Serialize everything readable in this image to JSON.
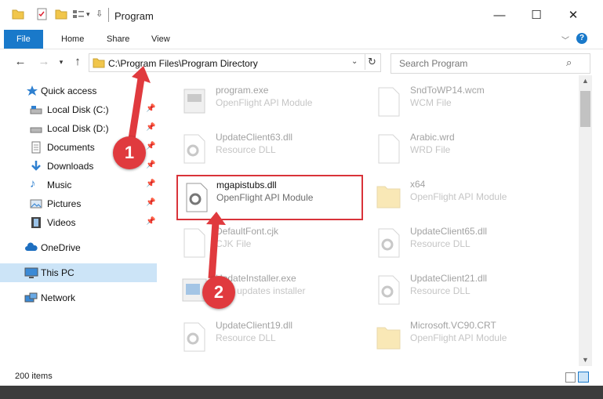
{
  "window": {
    "title": "Program"
  },
  "ribbon": {
    "tabs": [
      "File",
      "Home",
      "Share",
      "View"
    ]
  },
  "address": {
    "path": "C:\\Program Files\\Program Directory"
  },
  "search": {
    "placeholder": "Search Program"
  },
  "sidebar": {
    "items": [
      {
        "label": "Quick access"
      },
      {
        "label": "Local Disk (C:)"
      },
      {
        "label": "Local Disk (D:)"
      },
      {
        "label": "Documents"
      },
      {
        "label": "Downloads"
      },
      {
        "label": "Music"
      },
      {
        "label": "Pictures"
      },
      {
        "label": "Videos"
      },
      {
        "label": "OneDrive"
      },
      {
        "label": "This PC"
      },
      {
        "label": "Network"
      }
    ]
  },
  "files": [
    {
      "name": "program.exe",
      "desc": "OpenFlight API Module"
    },
    {
      "name": "SndToWP14.wcm",
      "desc": "WCM File"
    },
    {
      "name": "UpdateClient63.dll",
      "desc": "Resource DLL"
    },
    {
      "name": "Arabic.wrd",
      "desc": "WRD File"
    },
    {
      "name": "mgapistubs.dll",
      "desc": "OpenFlight API Module"
    },
    {
      "name": "x64",
      "desc": "OpenFlight API Module"
    },
    {
      "name": "DefaultFont.cjk",
      "desc": "CJK File"
    },
    {
      "name": "UpdateClient65.dll",
      "desc": "Resource DLL"
    },
    {
      "name": "UpdateInstaller.exe",
      "desc": "KEY updates installer"
    },
    {
      "name": "UpdateClient21.dll",
      "desc": "Resource DLL"
    },
    {
      "name": "UpdateClient19.dll",
      "desc": "Resource DLL"
    },
    {
      "name": "Microsoft.VC90.CRT",
      "desc": "OpenFlight API Module"
    }
  ],
  "status": {
    "count": "200 items"
  },
  "markers": [
    "1",
    "2"
  ],
  "colors": {
    "accent": "#1979ca",
    "highlight": "#d9333a"
  }
}
